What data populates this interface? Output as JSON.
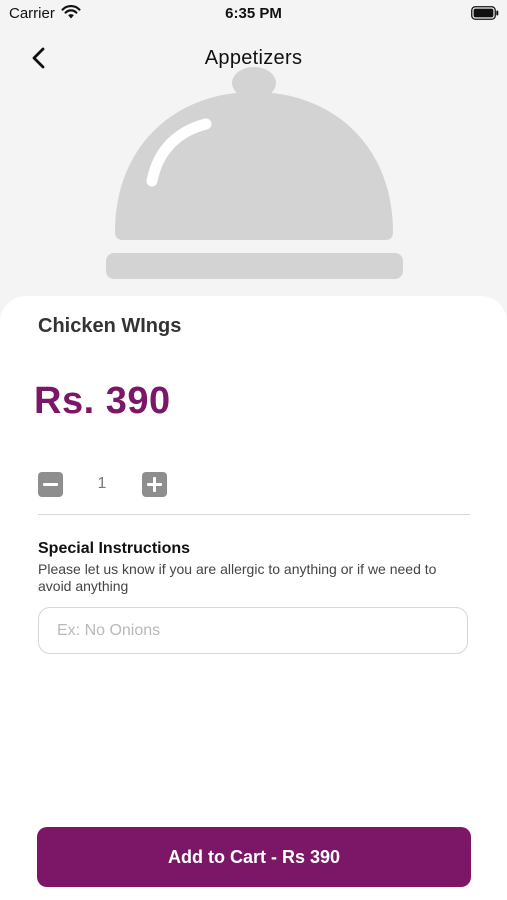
{
  "status_bar": {
    "carrier": "Carrier",
    "time": "6:35 PM",
    "wifi_icon": "wifi-icon",
    "battery_icon": "battery-icon"
  },
  "header": {
    "back_icon": "chevron-left-icon",
    "title": "Appetizers"
  },
  "hero": {
    "image_icon": "serving-cloche-icon",
    "image_color": "#d3d3d3"
  },
  "product": {
    "name": "Chicken WIngs",
    "price": "Rs. 390"
  },
  "quantity": {
    "minus_icon": "minus-icon",
    "value": "1",
    "plus_icon": "plus-icon"
  },
  "special_instructions": {
    "title": "Special Instructions",
    "description": "Please let us know if you are allergic to anything or if we need to avoid anything",
    "placeholder": "Ex: No Onions",
    "value": ""
  },
  "cart": {
    "button_label": "Add to Cart - Rs 390"
  },
  "colors": {
    "accent": "#7b1766",
    "background": "#f4f4f4",
    "card": "#ffffff",
    "icon_gray": "#8e8e8e"
  }
}
